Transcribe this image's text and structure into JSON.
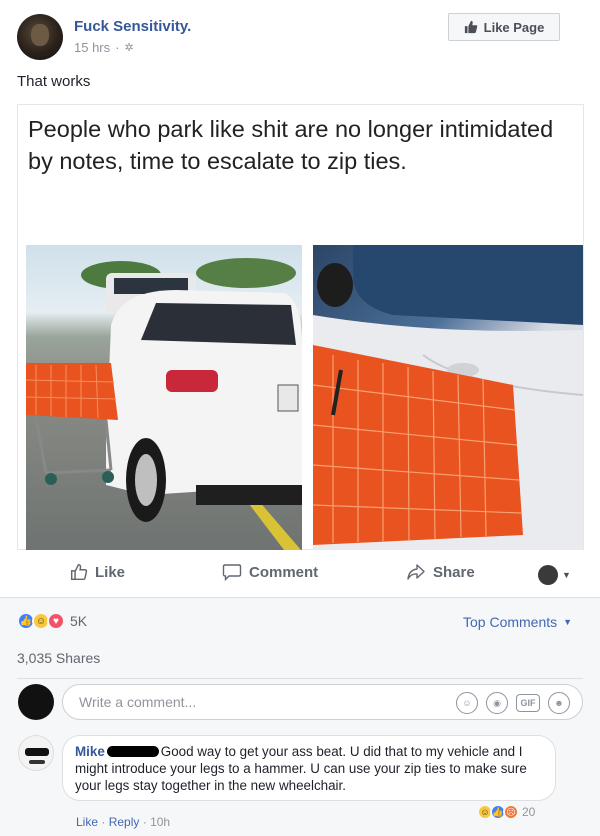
{
  "post": {
    "page_name": "Fuck Sensitivity.",
    "time": "15 hrs",
    "privacy_icon": "globe-icon",
    "like_page_label": "Like Page",
    "text": "That works"
  },
  "meme": {
    "caption": "People who park like shit are no longer intimidated by notes, time to escalate to zip ties."
  },
  "actions": {
    "like": "Like",
    "comment": "Comment",
    "share": "Share"
  },
  "stats": {
    "reactions": [
      "like",
      "haha",
      "love"
    ],
    "reaction_count": "5K",
    "top_comments": "Top Comments",
    "shares": "3,035 Shares"
  },
  "comment_box": {
    "placeholder": "Write a comment..."
  },
  "comment": {
    "name": "Mike",
    "text": "Good way to get your ass beat. U did that to my vehicle and I might introduce your legs to a hammer. U can use your zip ties to make sure your legs stay together in the new wheelchair.",
    "reaction_count": "20",
    "like": "Like",
    "reply": "Reply",
    "time": "10h"
  },
  "colors": {
    "link_blue": "#365899",
    "action_blue": "#4267b2",
    "cart_orange": "#e8531f"
  }
}
